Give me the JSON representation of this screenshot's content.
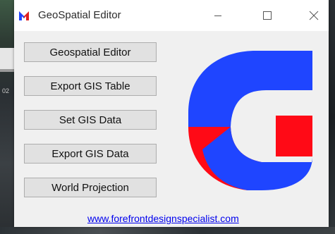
{
  "window": {
    "title": "GeoSpatial Editor",
    "icon": "m-logo-icon"
  },
  "titlebar_controls": {
    "minimize": "minimize-icon",
    "maximize": "maximize-icon",
    "close": "close-icon"
  },
  "background": {
    "left_text": "02"
  },
  "buttons": [
    {
      "label": "Geospatial Editor"
    },
    {
      "label": "Export GIS Table"
    },
    {
      "label": "Set GIS Data"
    },
    {
      "label": "Export GIS Data"
    },
    {
      "label": "World Projection"
    }
  ],
  "logo": {
    "name": "g-logo-icon",
    "colors": {
      "blue": "#1f45ff",
      "red": "#ff0a16"
    }
  },
  "link": {
    "text": "www.forefrontdesignspecialist.com"
  },
  "app_icon_colors": {
    "red": "#e02020",
    "blue": "#1f45ff"
  }
}
